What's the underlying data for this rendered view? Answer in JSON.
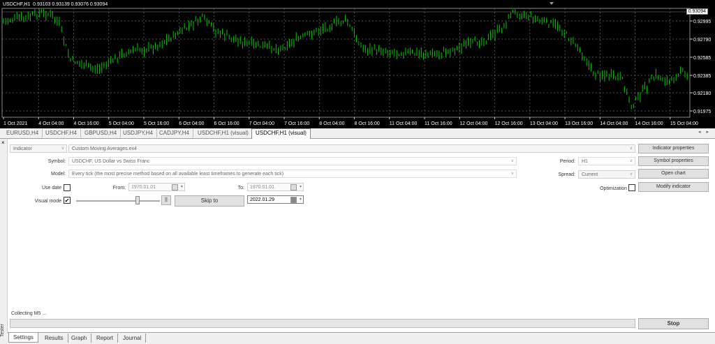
{
  "chart": {
    "info": "USDCHF,H1  0.93103 0.93139 0.93076 0.93094",
    "current_price": "0.93094",
    "price_labels": [
      "0.92995",
      "0.92790",
      "0.92585",
      "0.92385",
      "0.92180",
      "0.91975"
    ],
    "time_labels": [
      "1 Oct 2021",
      "4 Oct 04:00",
      "4 Oct 16:00",
      "5 Oct 04:00",
      "5 Oct 16:00",
      "6 Oct 04:00",
      "6 Oct 16:00",
      "7 Oct 04:00",
      "7 Oct 16:00",
      "8 Oct 04:00",
      "8 Oct 16:00",
      "11 Oct 04:00",
      "11 Oct 16:00",
      "12 Oct 04:00",
      "12 Oct 16:00",
      "13 Oct 04:00",
      "13 Oct 16:00",
      "14 Oct 04:00",
      "14 Oct 16:00",
      "15 Oct 04:00"
    ],
    "colors": {
      "background": "#000000",
      "candles": "#00c800",
      "grid": "#6e6e6e"
    }
  },
  "chart_tabs": [
    "EURUSD,H4",
    "USDCHF,H4",
    "GBPUSD,H4",
    "USDJPY,H4",
    "CADJPY,H4",
    "USDCHF,H1 (visual)",
    "USDCHF,H1 (visual)"
  ],
  "chart_tabs_active": 6,
  "tester": {
    "type_select": "Indicator",
    "expert_select": "Custom Moving Averages.ex4",
    "symbol_label": "Symbol:",
    "symbol_value": "USDCHF, US Dollar vs Swiss Franc",
    "model_label": "Model:",
    "model_value": "Every tick (the most precise method based on all available least timeframes to generate each tick)",
    "use_date_label": "Use date",
    "from_label": "From:",
    "from_value": "1970.01.01",
    "to_label": "To:",
    "to_value": "1970.01.01",
    "visual_mode_label": "Visual mode",
    "visual_mode_checked": "✔",
    "pause_label": "||",
    "skip_to_label": "Skip to",
    "skip_date": "2022.01.29",
    "period_label": "Period:",
    "period_value": "H1",
    "spread_label": "Spread:",
    "spread_value": "Current",
    "optimization_label": "Optimization",
    "buttons": {
      "indicator_properties": "Indicator properties",
      "symbol_properties": "Symbol properties",
      "open_chart": "Open chart",
      "modify_indicator": "Modify indicator",
      "stop": "Stop"
    },
    "status": "Collecting M5 ...",
    "side_label": "Tester",
    "close_glyph": "×"
  },
  "bottom_tabs": [
    "Settings",
    "Results",
    "Graph",
    "Report",
    "Journal"
  ],
  "bottom_tabs_active": 0
}
